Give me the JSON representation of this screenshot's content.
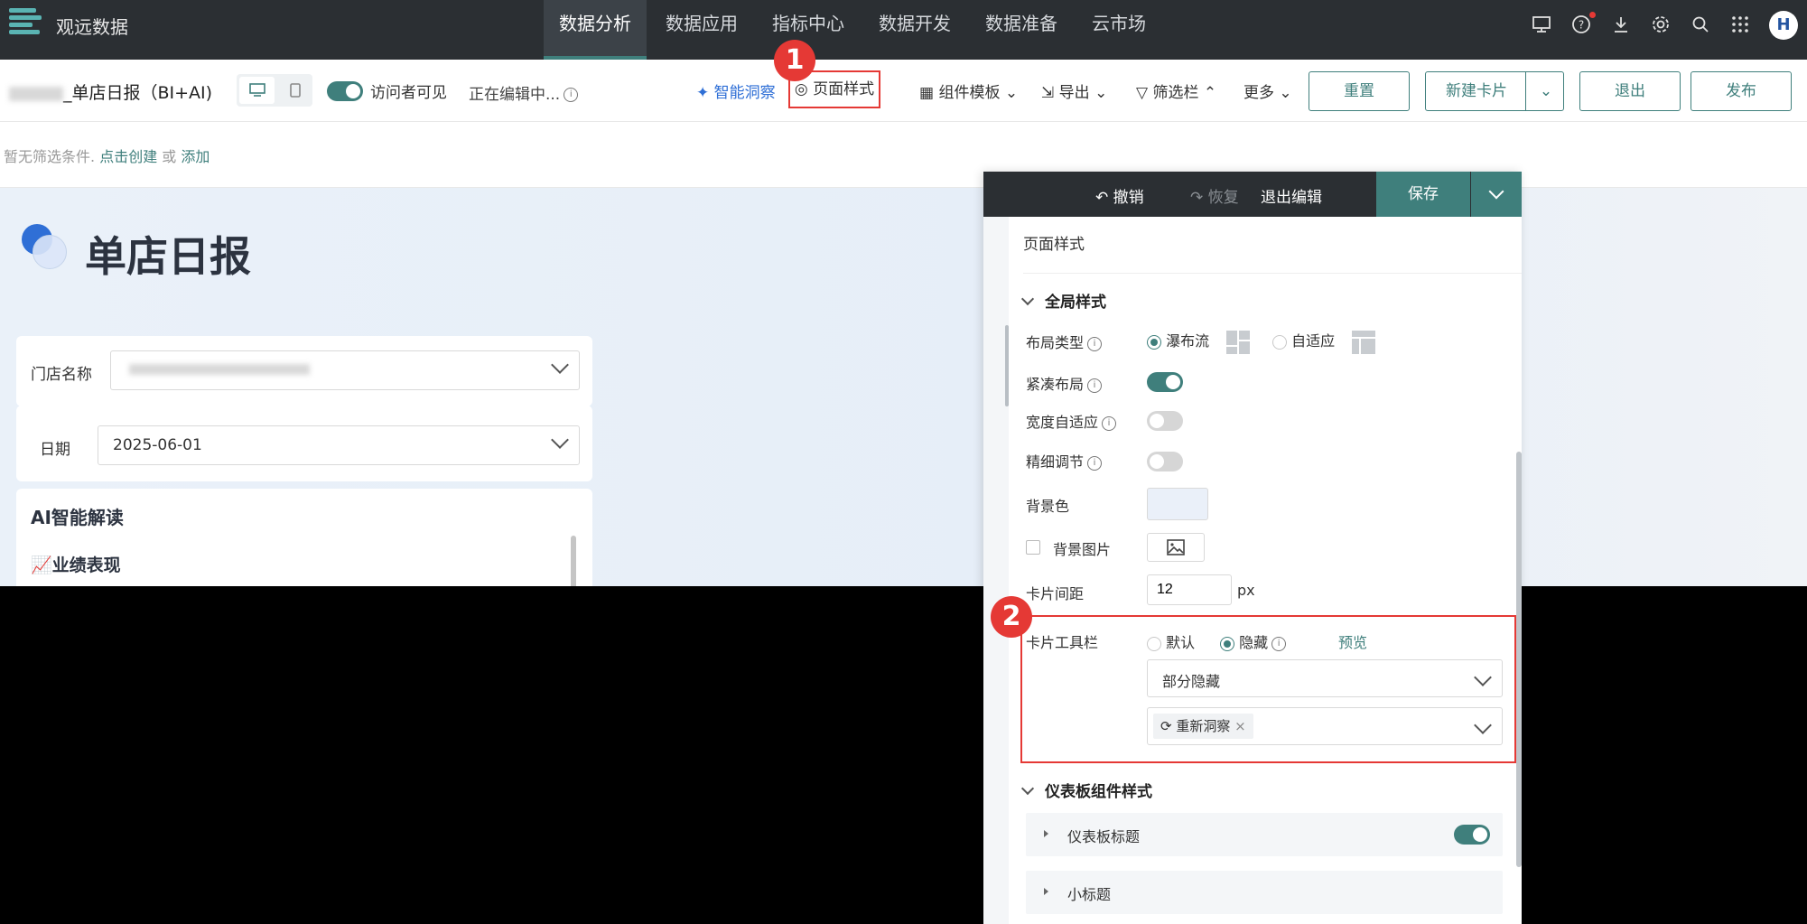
{
  "app": {
    "name": "观远数据",
    "logo_icon": "guandata-logo-icon"
  },
  "nav": {
    "tabs": [
      {
        "label": "数据分析",
        "active": true
      },
      {
        "label": "数据应用"
      },
      {
        "label": "指标中心"
      },
      {
        "label": "数据开发"
      },
      {
        "label": "数据准备"
      },
      {
        "label": "云市场"
      }
    ],
    "icons": [
      "monitor-icon",
      "help-icon",
      "download-icon",
      "settings-icon",
      "search-icon",
      "apps-grid-icon"
    ],
    "avatar_text": "H"
  },
  "toolbar": {
    "title": "_单店日报（BI+AI)",
    "visitor_visible": "访问者可见",
    "editing": "正在编辑中...",
    "smart_insight": "智能洞察",
    "page_style": "页面样式",
    "component_template": "组件模板",
    "export": "导出",
    "filter_bar": "筛选栏",
    "more": "更多",
    "reset": "重置",
    "new_card": "新建卡片",
    "exit": "退出",
    "publish": "发布"
  },
  "filterbar": {
    "text": "暂无筛选条件. ",
    "create_link": "点击创建",
    "or": " 或 ",
    "add_link": "添加"
  },
  "canvas": {
    "heading": "单店日报",
    "store_label": "门店名称",
    "date_label": "日期",
    "date_value": "2025-06-01",
    "ai_title": "AI智能解读",
    "ai_subtitle": "📈业绩表现"
  },
  "panel": {
    "undo": "撤销",
    "redo": "恢复",
    "exit_edit": "退出编辑",
    "save": "保存",
    "subtitle": "页面样式",
    "global_section": "全局样式",
    "layout_type": "布局类型",
    "layout_waterfall": "瀑布流",
    "layout_adaptive": "自适应",
    "compact_layout": "紧凑布局",
    "width_adaptive": "宽度自适应",
    "fine_tune": "精细调节",
    "bg_color": "背景色",
    "bg_image": "背景图片",
    "card_gap": "卡片间距",
    "card_gap_value": "12",
    "card_gap_unit": "px",
    "card_toolbar": "卡片工具栏",
    "toolbar_default": "默认",
    "toolbar_hide": "隐藏",
    "preview": "预览",
    "partial_hide": "部分隐藏",
    "tag_reinsight": "重新洞察",
    "dashboard_section": "仪表板组件样式",
    "dashboard_title": "仪表板标题",
    "small_title": "小标题"
  },
  "markers": [
    "1",
    "2"
  ],
  "colors": {
    "accent": "#3f7f7c",
    "nav_bg": "#2b2f33",
    "highlight": "#e53935",
    "link_blue": "#2f6fd6"
  }
}
